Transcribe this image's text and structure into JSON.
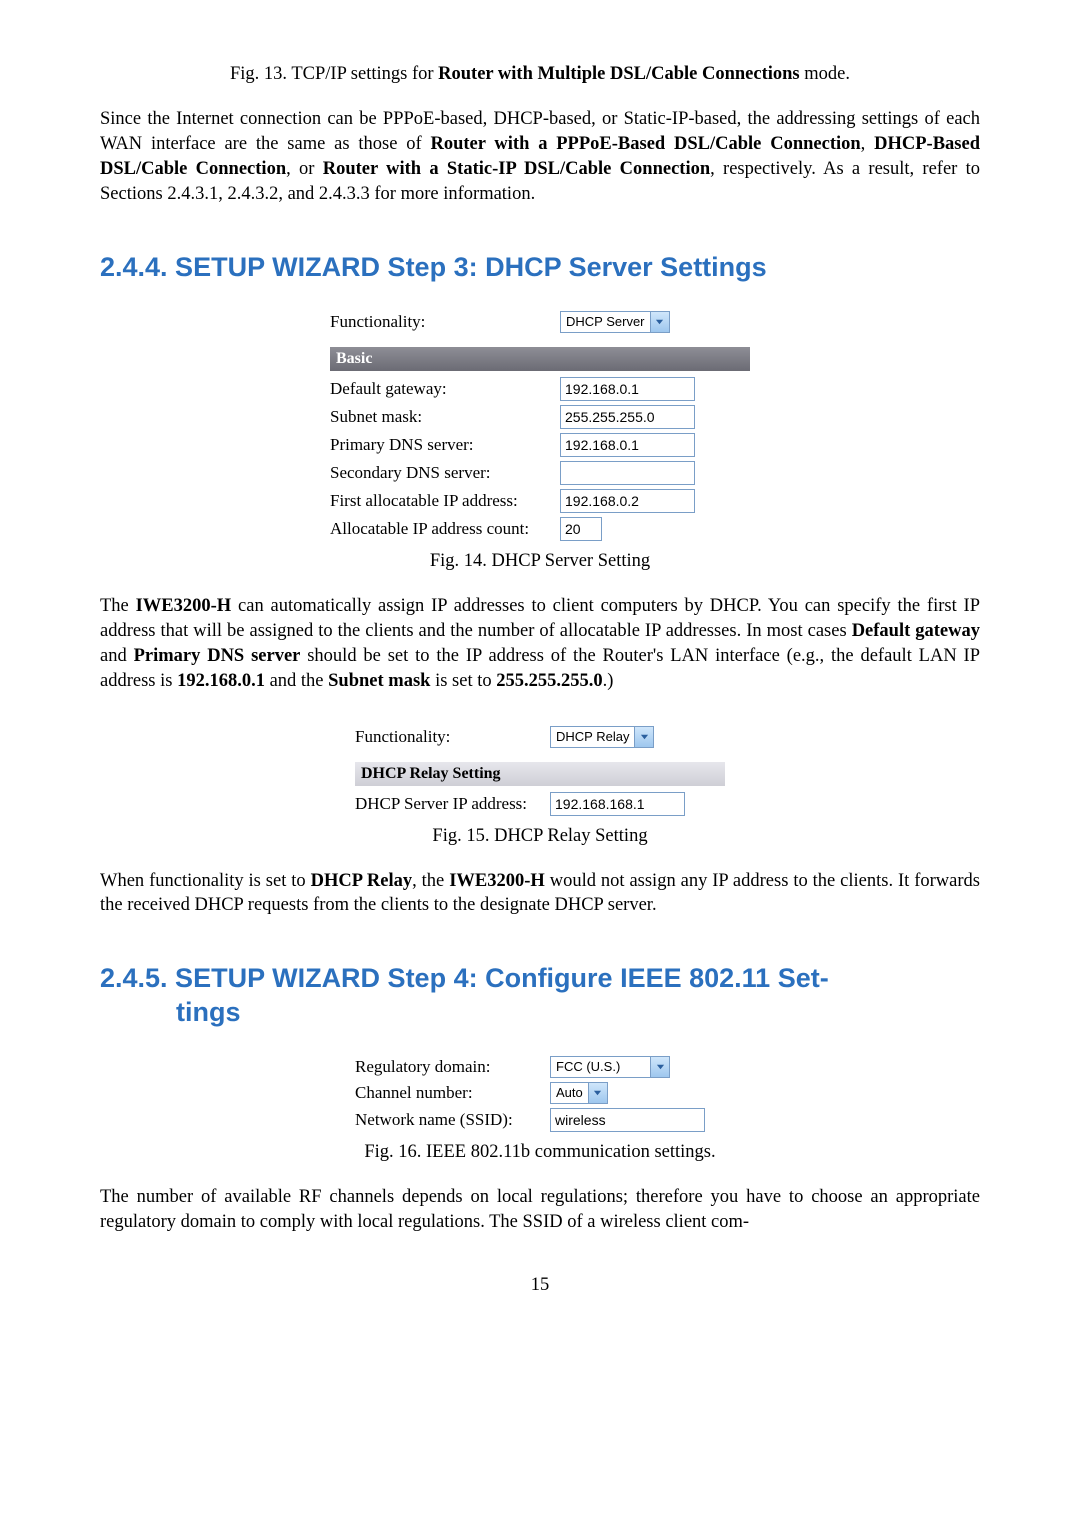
{
  "fig13_caption_prefix": "Fig. 13. TCP/IP settings for ",
  "fig13_caption_bold": "Router with Multiple DSL/Cable Connections",
  "fig13_caption_suffix": " mode.",
  "intro_para_1": "Since the Internet connection can be PPPoE-based, DHCP-based, or Static-IP-based, the addressing settings of each WAN interface are the same as those of ",
  "intro_bold_1": "Router with a PPPoE-Based DSL/Cable Connection",
  "intro_sep_1": ", ",
  "intro_bold_2": "DHCP-Based DSL/Cable Connection",
  "intro_sep_2": ", or ",
  "intro_bold_3": "Router with a Static-IP DSL/Cable Connection",
  "intro_tail": ", respectively. As a result, refer to Sections 2.4.3.1, 2.4.3.2, and 2.4.3.3 for more information.",
  "heading_244": "2.4.4. SETUP WIZARD Step 3: DHCP Server Settings",
  "dhcp": {
    "functionality_label": "Functionality:",
    "functionality_value": "DHCP Server",
    "basic_header": "Basic",
    "rows": {
      "default_gateway_label": "Default gateway:",
      "default_gateway_value": "192.168.0.1",
      "subnet_mask_label": "Subnet mask:",
      "subnet_mask_value": "255.255.255.0",
      "primary_dns_label": "Primary DNS server:",
      "primary_dns_value": "192.168.0.1",
      "secondary_dns_label": "Secondary DNS server:",
      "secondary_dns_value": "",
      "first_allocatable_label": "First allocatable IP address:",
      "first_allocatable_value": "192.168.0.2",
      "allocatable_count_label": "Allocatable IP address count:",
      "allocatable_count_value": "20"
    }
  },
  "fig14_caption": "Fig. 14. DHCP Server Setting",
  "para_dhcp_1a": "The ",
  "para_dhcp_1_bold1": "IWE3200-H",
  "para_dhcp_1b": " can automatically assign IP addresses to client computers by DHCP. You can specify the first IP address that will be assigned to the clients and the number of allocatable IP addresses. In most cases ",
  "para_dhcp_1_bold2": "Default gateway",
  "para_dhcp_1c": " and ",
  "para_dhcp_1_bold3": "Primary DNS server",
  "para_dhcp_1d": " should be set to the IP address of the Router's LAN interface (e.g., the default LAN IP address is ",
  "para_dhcp_1_bold4": "192.168.0.1",
  "para_dhcp_1e": " and the ",
  "para_dhcp_1_bold5": "Subnet mask",
  "para_dhcp_1f": " is set to ",
  "para_dhcp_1_bold6": "255.255.255.0",
  "para_dhcp_1g": ".)",
  "relay": {
    "functionality_label": "Functionality:",
    "functionality_value": "DHCP Relay",
    "header": "DHCP Relay Setting",
    "server_ip_label": "DHCP Server IP address:",
    "server_ip_value": "192.168.168.1"
  },
  "fig15_caption": "Fig. 15. DHCP Relay Setting",
  "para_relay_a": "When functionality is set to ",
  "para_relay_bold1": "DHCP Relay",
  "para_relay_b": ", the ",
  "para_relay_bold2": "IWE3200-H",
  "para_relay_c": " would not assign any IP address to the clients. It forwards the received DHCP requests from the clients to the designate DHCP server.",
  "heading_245_line1": "2.4.5. SETUP WIZARD Step 4: Configure IEEE 802.11 Set-",
  "heading_245_line2": "tings",
  "ieee": {
    "regulatory_label": "Regulatory domain:",
    "regulatory_value": "FCC (U.S.)",
    "channel_label": "Channel number:",
    "channel_value": "Auto",
    "ssid_label": "Network name (SSID):",
    "ssid_value": "wireless"
  },
  "fig16_caption": "Fig. 16. IEEE 802.11b communication settings.",
  "para_ieee": "The number of available RF channels depends on local regulations; therefore you have to choose an appropriate regulatory domain to comply with local regulations. The SSID of a wireless client com-",
  "page_number": "15"
}
